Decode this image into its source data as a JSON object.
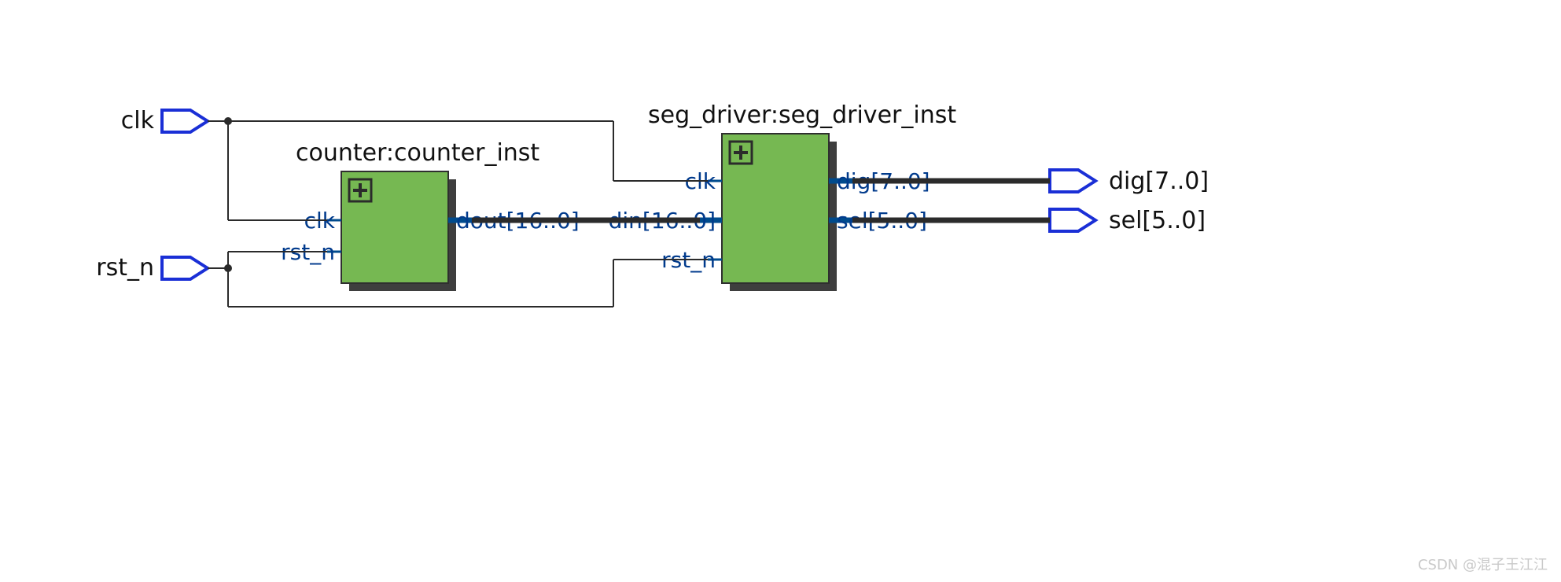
{
  "inputs": {
    "clk": "clk",
    "rst_n": "rst_n"
  },
  "outputs": {
    "dig": "dig[7..0]",
    "sel": "sel[5..0]"
  },
  "blocks": {
    "counter": {
      "title": "counter:counter_inst",
      "ports": {
        "clk": "clk",
        "rst_n": "rst_n",
        "dout": "dout[16..0]"
      }
    },
    "seg": {
      "title": "seg_driver:seg_driver_inst",
      "ports": {
        "clk": "clk",
        "din": "din[16..0]",
        "rst_n": "rst_n",
        "dig": "dig[7..0]",
        "sel": "sel[5..0]"
      }
    }
  },
  "watermark": "CSDN @混子王江江"
}
